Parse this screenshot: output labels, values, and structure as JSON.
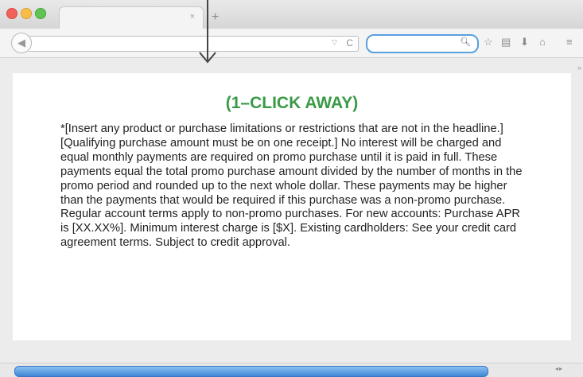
{
  "browser": {
    "tab_close": "×",
    "new_tab": "+",
    "url": "",
    "search_placeholder": "",
    "icons": [
      "back-icon",
      "dropmarker-icon",
      "reload-icon",
      "search-icon",
      "star-icon",
      "bookmarks-icon",
      "download-icon",
      "home-icon",
      "menu-icon"
    ]
  },
  "page": {
    "headline": "(1–CLICK AWAY)",
    "disclaimer": "*[Insert any product or purchase limitations or restrictions that are not in the headline.] [Qualifying purchase amount must be on one receipt.] No interest will be charged and equal monthly payments are required on promo purchase until it is paid in full. These payments equal the total promo purchase amount divided by the number of months in the promo period and rounded up to the next whole dollar. These payments may be higher than the payments that would be required if this purchase was a non-promo purchase. Regular account terms apply to non-promo purchases. For new accounts: Purchase APR is [XX.XX%]. Minimum interest charge is [$X]. Existing cardholders: See your credit card agreement terms. Subject to credit approval."
  },
  "colors": {
    "headline": "#3a9a46",
    "search_focus": "#5a9fe0",
    "scrollbar": "#3f86d6"
  }
}
